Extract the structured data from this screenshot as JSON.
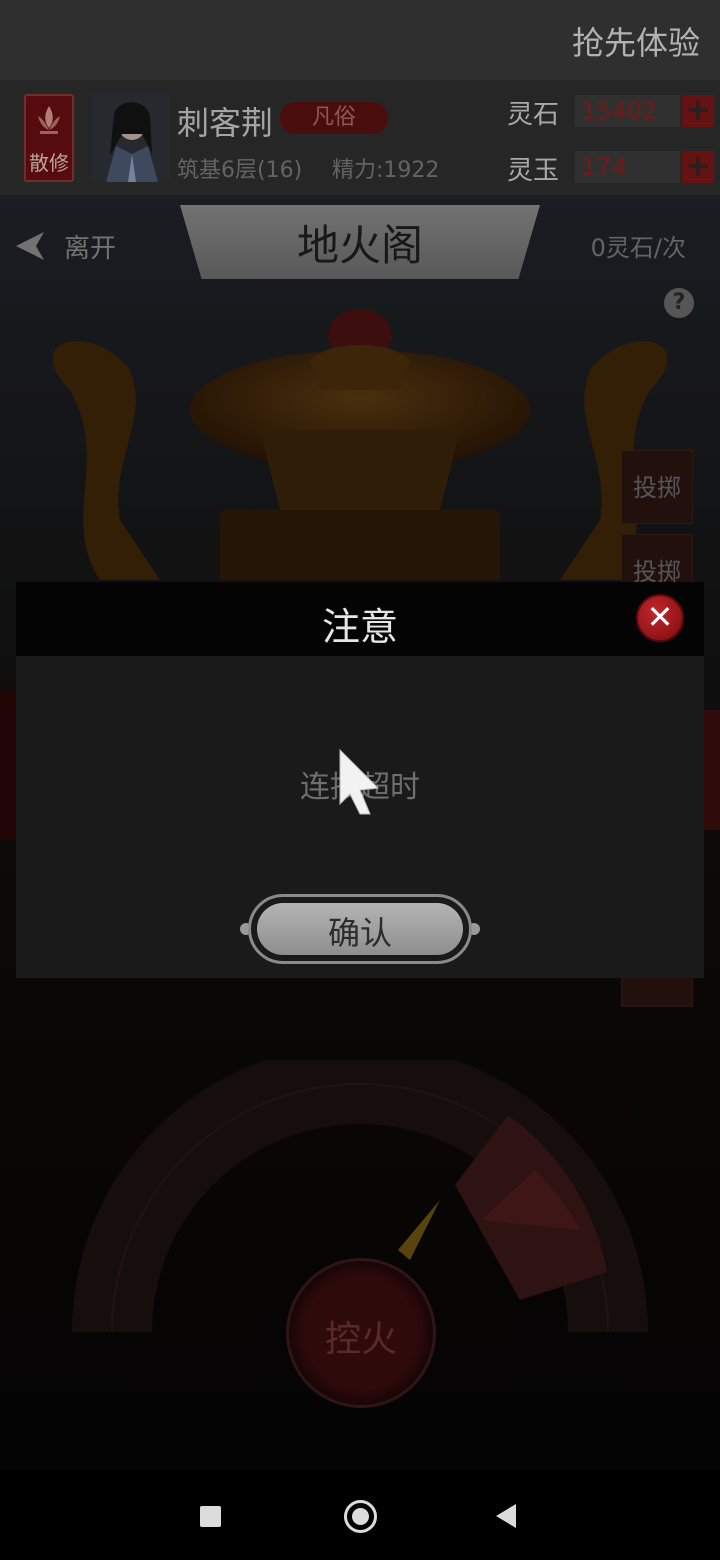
{
  "header": {
    "promo_link": "抢先体验"
  },
  "player": {
    "sect_label": "散修",
    "name": "刺客荆",
    "rank_badge": "凡俗",
    "realm": "筑基6层(16)",
    "energy": "精力:1922"
  },
  "resources": {
    "spirit_stone_label": "灵石",
    "spirit_stone_value": "15402",
    "spirit_jade_label": "灵玉",
    "spirit_jade_value": "174",
    "plus_symbol": "+"
  },
  "scene": {
    "back_label": "离开",
    "title": "地火阁",
    "cost": "0灵石/次",
    "help_symbol": "?",
    "throw_label_1": "投掷",
    "throw_label_2": "投掷",
    "fire_button_label": "控火"
  },
  "dialog": {
    "title": "注意",
    "message": "连接超时",
    "confirm_label": "确认",
    "close_symbol": "✕"
  },
  "colors": {
    "accent_red": "#c1262a",
    "resource_value_red": "#8a2020"
  },
  "icons": {
    "sect_badge": "lotus-icon",
    "back": "back-arrow-icon",
    "help": "help-icon",
    "close": "close-icon",
    "cursor": "pointer-cursor-icon",
    "nav_recent": "recent-apps-icon",
    "nav_home": "home-icon",
    "nav_back": "back-icon"
  }
}
